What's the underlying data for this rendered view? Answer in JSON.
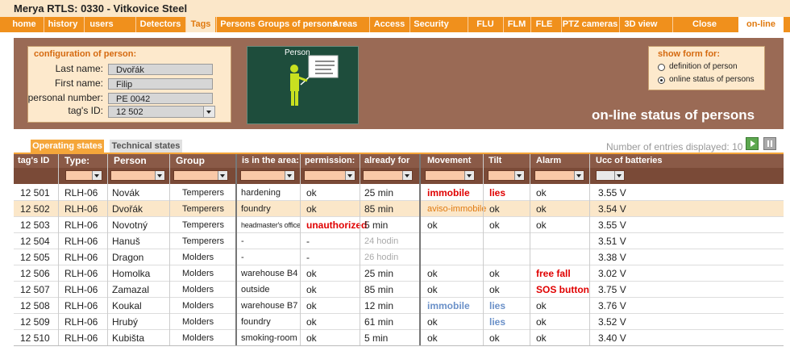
{
  "app_title": "Merya RTLS:  0330 - Vitkovice Steel",
  "nav": {
    "home": "home",
    "history": "history",
    "users": "users",
    "detectors": "Detectors",
    "tags": "Tags",
    "persons": "Persons",
    "groups_of_persons": "Groups of persons",
    "areas": "Areas",
    "access": "Access",
    "security": "Security",
    "flu": "FLU",
    "flm": "FLM",
    "fle": "FLE",
    "ptz_cameras": "PTZ cameras",
    "view_3d": "3D view",
    "close": "Close",
    "online": "on-line"
  },
  "config": {
    "header": "configuration of person:",
    "last_name_label": "Last name:",
    "last_name_value": "Dvořák",
    "first_name_label": "First name:",
    "first_name_value": "Filip",
    "personal_number_label": "personal number:",
    "personal_number_value": "PE 0042",
    "tag_id_label": "tag's ID:",
    "tag_id_value": "12 502"
  },
  "board_label": "Person",
  "show_form": {
    "header": "show form for:",
    "option1": "definition of person",
    "option2": "online status of persons",
    "selected": "online status of persons"
  },
  "page_title": "on-line status of persons",
  "tabs": {
    "operating": "Operating states",
    "technical": "Technical states"
  },
  "entries_text": "Number of entries displayed: 10",
  "colors": {
    "nav_orange": "#f0901c",
    "panel_brown": "#9a6a55",
    "header_brown": "#8a5a47",
    "alert_red": "#e00000",
    "info_blue": "#6a90c8"
  },
  "columns": {
    "tag_id": "tag's ID",
    "type": "Type:",
    "person": "Person",
    "group": "Group",
    "area": "is in the area:",
    "permission": "permission:",
    "already_for": "already for",
    "movement": "Movement",
    "tilt": "Tilt",
    "alarm": "Alarm",
    "batteries": "Ucc of batteries"
  },
  "rows": [
    {
      "tag_id": "12 501",
      "type": "RLH-06",
      "person": "Novák",
      "group": "Temperers",
      "area": "hardening",
      "permission": "ok",
      "already_for": "25 min",
      "movement": "immobile",
      "tilt": "lies",
      "alarm": "ok",
      "battery": "3.55 V"
    },
    {
      "tag_id": "12 502",
      "type": "RLH-06",
      "person": "Dvořák",
      "group": "Temperers",
      "area": "foundry",
      "permission": "ok",
      "already_for": "85 min",
      "movement": "aviso-immobile",
      "tilt": "ok",
      "alarm": "ok",
      "battery": "3.54 V"
    },
    {
      "tag_id": "12 503",
      "type": "RLH-06",
      "person": "Novotný",
      "group": "Temperers",
      "area": "headmaster's office",
      "permission": "unauthorized",
      "already_for": "5 min",
      "movement": "ok",
      "tilt": "ok",
      "alarm": "ok",
      "battery": "3.55 V"
    },
    {
      "tag_id": "12 504",
      "type": "RLH-06",
      "person": "Hanuš",
      "group": "Temperers",
      "area": "-",
      "permission": "-",
      "already_for": "24 hodin",
      "movement": "",
      "tilt": "",
      "alarm": "",
      "battery": "3.51 V"
    },
    {
      "tag_id": "12 505",
      "type": "RLH-06",
      "person": "Dragon",
      "group": "Molders",
      "area": "-",
      "permission": "-",
      "already_for": "26 hodin",
      "movement": "",
      "tilt": "",
      "alarm": "",
      "battery": "3.38 V"
    },
    {
      "tag_id": "12 506",
      "type": "RLH-06",
      "person": "Homolka",
      "group": "Molders",
      "area": "warehouse B4",
      "permission": "ok",
      "already_for": "25 min",
      "movement": "ok",
      "tilt": "ok",
      "alarm": "free fall",
      "battery": "3.02 V"
    },
    {
      "tag_id": "12 507",
      "type": "RLH-06",
      "person": "Zamazal",
      "group": "Molders",
      "area": "outside",
      "permission": "ok",
      "already_for": "85 min",
      "movement": "ok",
      "tilt": "ok",
      "alarm": "SOS button",
      "battery": "3.75 V"
    },
    {
      "tag_id": "12 508",
      "type": "RLH-06",
      "person": "Koukal",
      "group": "Molders",
      "area": "warehouse B7",
      "permission": "ok",
      "already_for": "12 min",
      "movement": "immobile",
      "tilt": "lies",
      "alarm": "ok",
      "battery": "3.76 V"
    },
    {
      "tag_id": "12 509",
      "type": "RLH-06",
      "person": "Hrubý",
      "group": "Molders",
      "area": "foundry",
      "permission": "ok",
      "already_for": "61 min",
      "movement": "ok",
      "tilt": "lies",
      "alarm": "ok",
      "battery": "3.52 V"
    },
    {
      "tag_id": "12 510",
      "type": "RLH-06",
      "person": "Kubišta",
      "group": "Molders",
      "area": "smoking-room",
      "permission": "ok",
      "already_for": "5 min",
      "movement": "ok",
      "tilt": "ok",
      "alarm": "ok",
      "battery": "3.40 V"
    }
  ]
}
